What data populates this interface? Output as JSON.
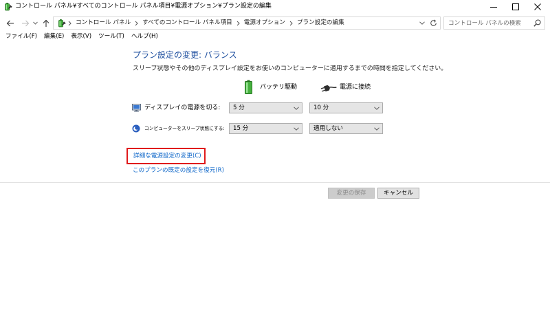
{
  "window": {
    "title": "コントロール パネル¥すべてのコントロール パネル項目¥電源オプション¥プラン設定の編集",
    "icon": "power-options-icon",
    "controls": [
      "minimize-icon",
      "maximize-icon",
      "close-icon"
    ]
  },
  "navigation": {
    "buttons": [
      "back-arrow-icon",
      "forward-arrow-icon",
      "recent-locations-icon",
      "up-arrow-icon"
    ]
  },
  "address_bar": {
    "icon": "power-options-icon",
    "crumbs": [
      "コントロール パネル",
      "すべてのコントロール パネル項目",
      "電源オプション",
      "プラン設定の編集"
    ],
    "separator_icon": "chevron-right-icon",
    "dropdown_icon": "chevron-down-icon",
    "refresh_icon": "refresh-icon"
  },
  "search": {
    "placeholder": "コントロール パネルの検索",
    "icon": "search-icon"
  },
  "menu": {
    "items": [
      "ファイル(F)",
      "編集(E)",
      "表示(V)",
      "ツール(T)",
      "ヘルプ(H)"
    ]
  },
  "plan": {
    "title": "プラン設定の変更: バランス",
    "description": "スリープ状態やその他のディスプレイ設定をお使いのコンピューターに適用するまでの時間を指定してください。",
    "columns": {
      "battery": {
        "label": "バッテリ駆動",
        "icon": "battery-icon"
      },
      "plugged_in": {
        "label": "電源に接続",
        "icon": "power-plug-icon"
      }
    },
    "settings": [
      {
        "label": "ディスプレイの電源を切る:",
        "icon": "display-icon",
        "battery": "5 分",
        "plugged_in": "10 分"
      },
      {
        "label": "コンピューターをスリープ状態にする:",
        "icon": "sleep-icon",
        "battery": "15 分",
        "plugged_in": "適用しない"
      }
    ],
    "links": {
      "advanced": "詳細な電源設定の変更(C)",
      "restore_defaults": "このプランの既定の設定を復元(R)"
    }
  },
  "actions": {
    "save": {
      "label": "変更の保存",
      "enabled": false
    },
    "cancel": {
      "label": "キャンセル",
      "enabled": true
    }
  },
  "colors": {
    "heading": "#1e4f9f",
    "link": "#0a64c8",
    "body_text": "#1e1e1e",
    "separator": "#e2e2e2",
    "highlight": "#e0191b",
    "field_border": "#adadad",
    "field_background": "#e5e5e5",
    "disabled_button_background": "#cccccc",
    "disabled_button_text": "#8a8a8a",
    "battery_green": "#46b03f",
    "sleep_blue": "#2b5fbf"
  }
}
